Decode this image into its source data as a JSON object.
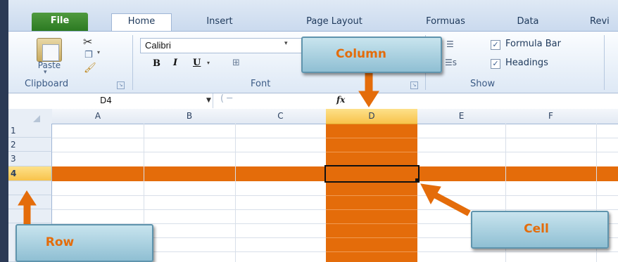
{
  "ribbon": {
    "tabs": [
      "File",
      "Home",
      "Insert",
      "Page Layout",
      "Formuas",
      "Data",
      "Revi"
    ],
    "clipboard": {
      "paste_label": "Paste",
      "group_label": "Clipboard"
    },
    "font": {
      "font_name": "Calibri",
      "bold": "B",
      "italic": "I",
      "underline": "U",
      "group_label": "Font"
    },
    "show": {
      "formula_bar_label": "Formula Bar",
      "headings_label": "Headings",
      "group_label": "Show",
      "partial_label": "s"
    }
  },
  "formula_bar": {
    "name_box": "D4",
    "fx": "fx"
  },
  "grid": {
    "columns": [
      "A",
      "B",
      "C",
      "D",
      "E",
      "F"
    ],
    "rows": [
      "1",
      "2",
      "3",
      "4"
    ],
    "selected_column": "D",
    "selected_row": "4"
  },
  "callouts": {
    "column": "Column",
    "row": "Row",
    "cell": "Cell"
  },
  "colors": {
    "highlight": "#e46c0a",
    "callout_bg": "#a9d3e3",
    "file_tab": "#2e7d22"
  }
}
